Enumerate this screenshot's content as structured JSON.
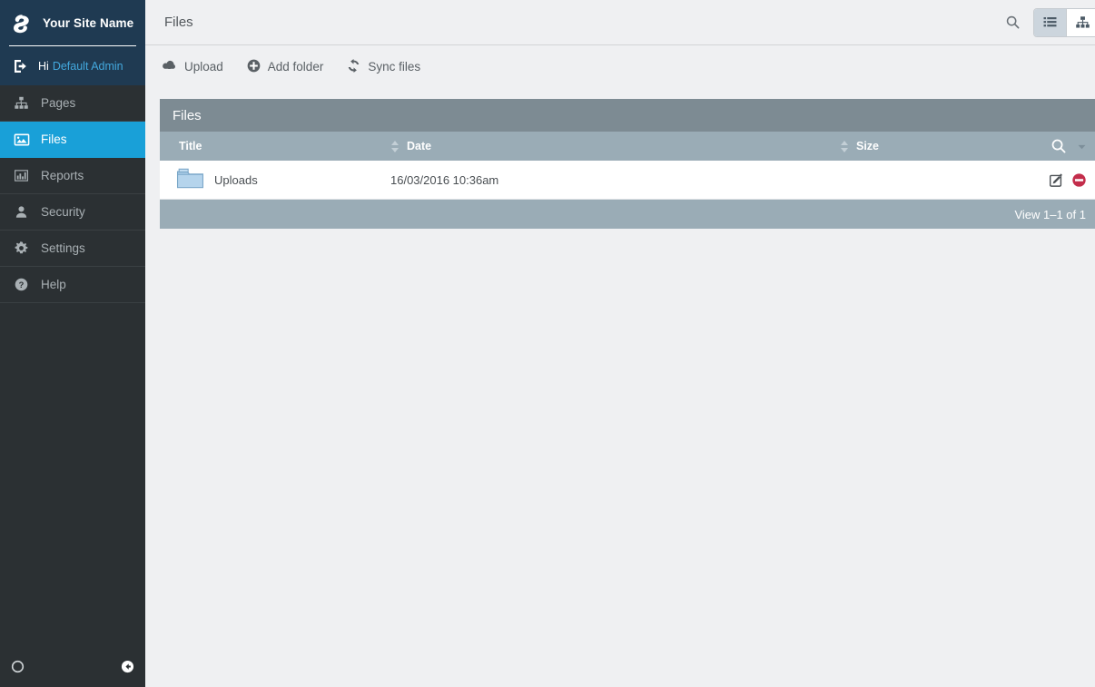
{
  "sidebar": {
    "brand": {
      "title": "Your Site Name",
      "logo_icon": "silverstripe-logo-icon"
    },
    "user": {
      "greeting": "Hi",
      "name": "Default Admin",
      "icon": "logout-icon"
    },
    "items": [
      {
        "label": "Pages",
        "icon": "sitemap-icon",
        "active": false
      },
      {
        "label": "Files",
        "icon": "image-icon",
        "active": true
      },
      {
        "label": "Reports",
        "icon": "barchart-icon",
        "active": false
      },
      {
        "label": "Security",
        "icon": "user-icon",
        "active": false
      },
      {
        "label": "Settings",
        "icon": "gear-icon",
        "active": false
      },
      {
        "label": "Help",
        "icon": "question-circle-icon",
        "active": false
      }
    ],
    "footer": {
      "status_icon": "circle-icon",
      "collapse_icon": "arrow-left-circle-icon"
    }
  },
  "header": {
    "title": "Files",
    "search_icon": "search-icon",
    "view_toggle": [
      {
        "icon": "list-view-icon",
        "selected": true
      },
      {
        "icon": "tree-view-icon",
        "selected": false
      }
    ]
  },
  "toolbar": {
    "actions": [
      {
        "label": "Upload",
        "icon": "cloud-upload-icon"
      },
      {
        "label": "Add folder",
        "icon": "plus-circle-icon"
      },
      {
        "label": "Sync files",
        "icon": "sync-icon"
      }
    ]
  },
  "panel": {
    "title": "Files",
    "columns": [
      {
        "label": "Title",
        "sortable": false
      },
      {
        "label": "Date",
        "sortable": true
      },
      {
        "label": "Size",
        "sortable": true
      }
    ],
    "filter": {
      "search_icon": "search-icon",
      "caret_icon": "chevron-down-icon"
    },
    "rows": [
      {
        "icon": "folder-icon",
        "title": "Uploads",
        "date": "16/03/2016 10:36am",
        "size": "",
        "actions": [
          {
            "icon": "edit-icon"
          },
          {
            "icon": "delete-icon"
          }
        ]
      }
    ],
    "footer_text": "View 1–1 of 1"
  },
  "colors": {
    "brand_bg": "#1f3a52",
    "sidebar_bg": "#2b3033",
    "accent": "#19a0d8",
    "panel_head": "#7d8b93",
    "panel_sub": "#9aacb6",
    "main_bg": "#eff0f2",
    "delete": "#c32d4b"
  }
}
